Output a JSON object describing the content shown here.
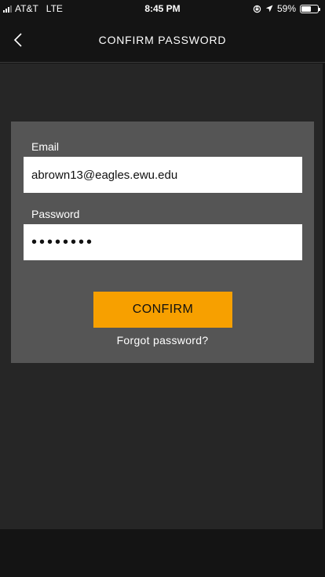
{
  "status_bar": {
    "carrier": "AT&T",
    "network": "LTE",
    "time": "8:45 PM",
    "battery": "59%",
    "battery_level": 0.59,
    "icons": [
      "signal-icon",
      "orientation-lock-icon",
      "location-arrow-icon",
      "battery-icon"
    ]
  },
  "nav": {
    "title": "CONFIRM PASSWORD",
    "back_icon": "chevron-left-icon"
  },
  "form": {
    "email_label": "Email",
    "email_value": "abrown13@eagles.ewu.edu",
    "password_label": "Password",
    "password_value": "••••••••",
    "confirm_label": "CONFIRM",
    "forgot_label": "Forgot password?"
  },
  "colors": {
    "accent": "#f7a000",
    "background": "#262626",
    "card": "#555555",
    "bar": "#141414"
  }
}
